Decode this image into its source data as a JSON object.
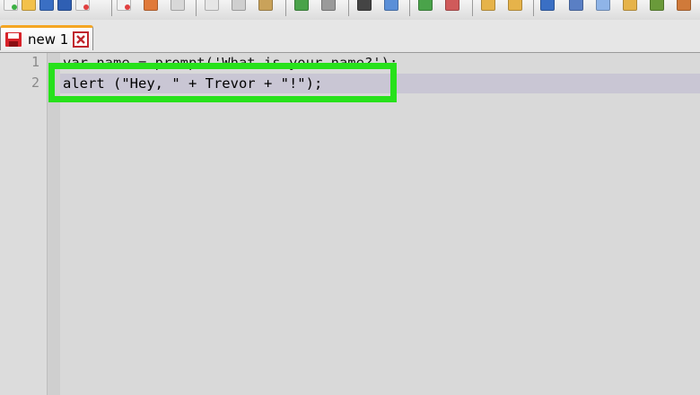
{
  "tab": {
    "label": "new 1"
  },
  "editor": {
    "lines": [
      {
        "number": "1",
        "text": "var name = prompt('What is your name?');",
        "visible_text": "var name = prompt('What is your name?');"
      },
      {
        "number": "2",
        "text": "alert (\"Hey, \" + Trevor + \"!\");"
      }
    ]
  },
  "colors": {
    "highlight": "#27e11b",
    "current_line": "#c9c6d4",
    "tab_accent": "#f5a623"
  },
  "icons": [
    "new-file-icon",
    "open-icon",
    "save-icon",
    "save-all-icon",
    "close-icon",
    "close-all-icon",
    "print-icon",
    "cut-icon",
    "copy-icon",
    "paste-icon",
    "undo-icon",
    "redo-icon",
    "find-icon",
    "replace-icon",
    "zoom-in-icon",
    "zoom-out-icon",
    "sync-v-icon",
    "sync-h-icon",
    "word-wrap-icon",
    "show-symbols-icon",
    "indent-guide-icon",
    "bookmark-icon",
    "macro-icon",
    "run-icon"
  ]
}
